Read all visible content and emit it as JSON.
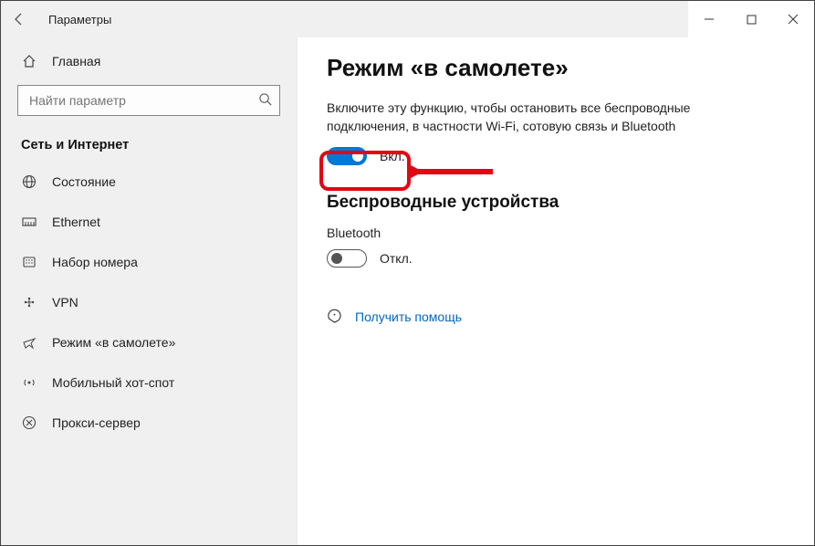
{
  "window_title": "Параметры",
  "search": {
    "placeholder": "Найти параметр"
  },
  "home_label": "Главная",
  "category": "Сеть и Интернет",
  "sidebar": {
    "items": [
      {
        "label": "Состояние"
      },
      {
        "label": "Ethernet"
      },
      {
        "label": "Набор номера"
      },
      {
        "label": "VPN"
      },
      {
        "label": "Режим «в самолете»"
      },
      {
        "label": "Мобильный хот-спот"
      },
      {
        "label": "Прокси-сервер"
      }
    ]
  },
  "page": {
    "title": "Режим «в самолете»",
    "description": "Включите эту функцию, чтобы остановить все беспроводные подключения, в частности Wi-Fi, сотовую связь и Bluetooth",
    "airplane_toggle_label": "Вкл.",
    "wireless_header": "Беспроводные устройства",
    "bt_label": "Bluetooth",
    "bt_toggle_label": "Откл.",
    "help_link": "Получить помощь"
  }
}
